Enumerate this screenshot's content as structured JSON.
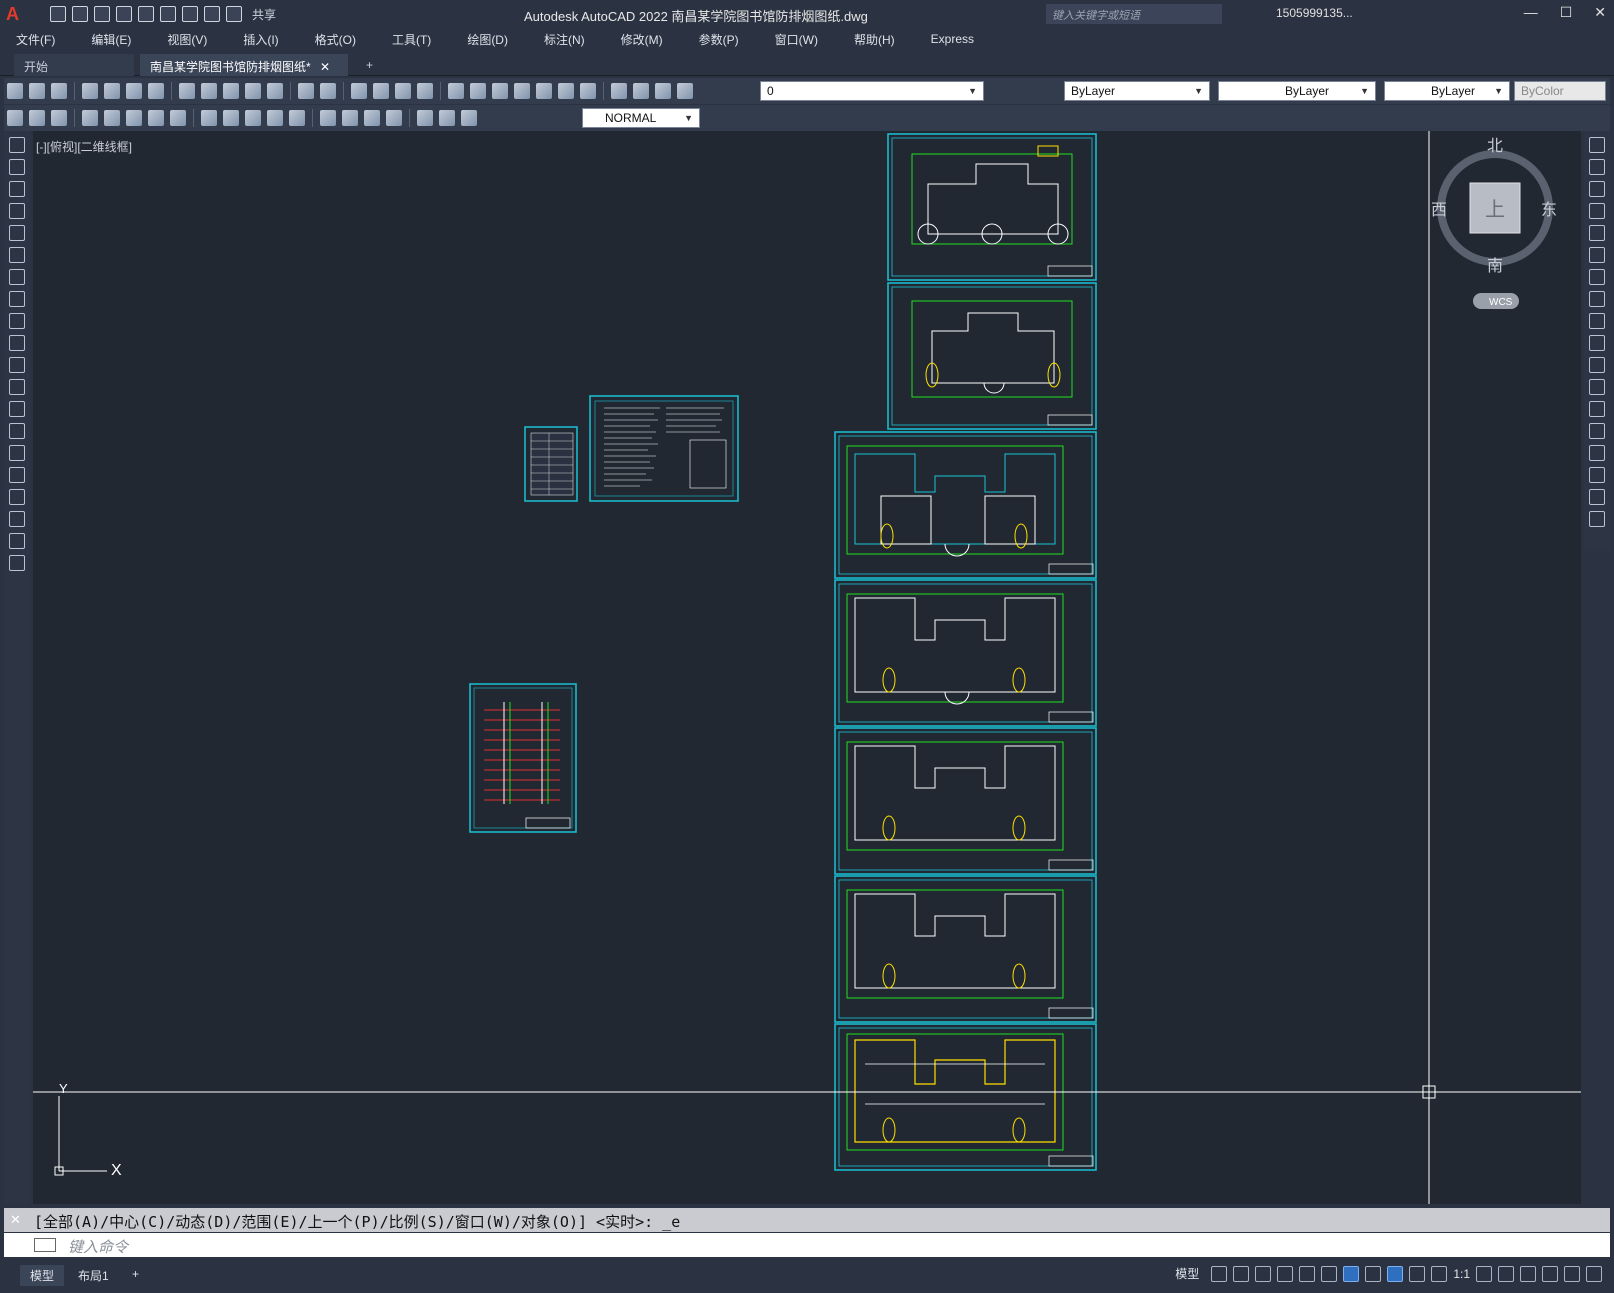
{
  "app": {
    "logo": "A",
    "title": "Autodesk AutoCAD 2022    南昌某学院图书馆防排烟图纸.dwg",
    "search_placeholder": "键入关键字或短语",
    "user": "1505999135...",
    "share": "共享"
  },
  "menu": [
    "文件(F)",
    "编辑(E)",
    "视图(V)",
    "插入(I)",
    "格式(O)",
    "工具(T)",
    "绘图(D)",
    "标注(N)",
    "修改(M)",
    "参数(P)",
    "窗口(W)",
    "帮助(H)",
    "Express"
  ],
  "tabs": {
    "start": "开始",
    "active": "南昌某学院图书馆防排烟图纸*",
    "close": "✕",
    "add": "+"
  },
  "toolbar": {
    "layer": "0",
    "color": "ByLayer",
    "linetype": "ByLayer",
    "lineweight": "ByLayer",
    "plotstyle": "ByColor",
    "style": "NORMAL"
  },
  "viewport": {
    "label": "[-][俯视][二维线框]",
    "viewcube": {
      "north": "北",
      "south": "南",
      "east": "东",
      "west": "西",
      "face": "上",
      "wcs": "WCS"
    },
    "ucs": {
      "x": "X",
      "y": "Y"
    }
  },
  "command": {
    "history": "[全部(A)/中心(C)/动态(D)/范围(E)/上一个(P)/比例(S)/窗口(W)/对象(O)] <实时>: _e",
    "placeholder": "键入命令"
  },
  "status": {
    "tabs": [
      "模型",
      "布局1"
    ],
    "add": "+",
    "mode": "模型",
    "scale": "1:1"
  },
  "colors": {
    "canvas": "#212832",
    "frame": "#19c3d6",
    "wall": "#ffffff",
    "dim": "#1fe01f",
    "accent": "#ffe000",
    "red": "#e03030"
  }
}
